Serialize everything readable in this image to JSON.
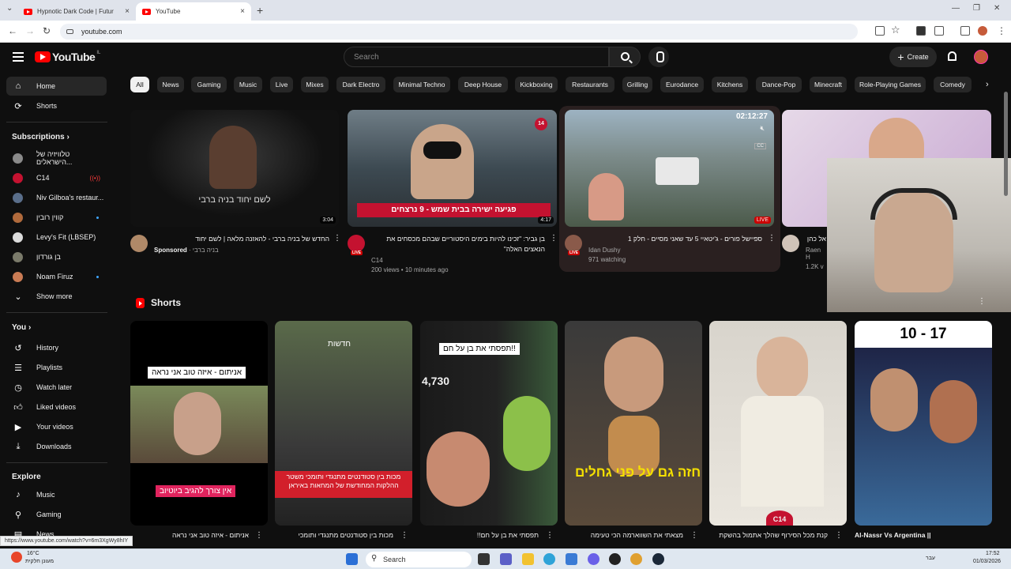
{
  "browser": {
    "tabs": [
      {
        "title": "Hypnotic Dark Code | Futur",
        "active": false
      },
      {
        "title": "YouTube",
        "active": true
      }
    ],
    "url": "youtube.com",
    "status_url": "https://www.youtube.com/watch?v=6m3XgWy8hIY"
  },
  "header": {
    "logo_text": "YouTube",
    "logo_country": "IL",
    "search_placeholder": "Search",
    "create_label": "Create"
  },
  "sidebar": {
    "main": [
      {
        "label": "Home",
        "icon": "home-icon"
      },
      {
        "label": "Shorts",
        "icon": "shorts-icon"
      }
    ],
    "subscriptions_title": "Subscriptions",
    "subscriptions": [
      {
        "label": "טלוויזיה של הישראלים...",
        "color": "#8a8a8a",
        "badge": ""
      },
      {
        "label": "C14",
        "color": "#c41230",
        "badge": "live"
      },
      {
        "label": "Niv Gilboa's restaur...",
        "color": "#5a6e8a",
        "badge": ""
      },
      {
        "label": "קווין רובין",
        "color": "#b06a3c",
        "badge": "dot"
      },
      {
        "label": "Levy's Fit (LBSEP)",
        "color": "#dcdcdc",
        "badge": ""
      },
      {
        "label": "בן גורדון",
        "color": "#7a7a6a",
        "badge": ""
      },
      {
        "label": "Noam Firuz",
        "color": "#c97b54",
        "badge": "dot"
      }
    ],
    "show_more": "Show more",
    "you_title": "You",
    "you": [
      {
        "label": "History",
        "icon": "history-icon"
      },
      {
        "label": "Playlists",
        "icon": "playlists-icon"
      },
      {
        "label": "Watch later",
        "icon": "watch-later-icon"
      },
      {
        "label": "Liked videos",
        "icon": "liked-icon"
      },
      {
        "label": "Your videos",
        "icon": "your-videos-icon"
      },
      {
        "label": "Downloads",
        "icon": "downloads-icon"
      }
    ],
    "explore_title": "Explore",
    "explore": [
      {
        "label": "Music",
        "icon": "music-icon"
      },
      {
        "label": "Gaming",
        "icon": "gaming-icon"
      },
      {
        "label": "News",
        "icon": "news-icon"
      }
    ]
  },
  "chips": [
    "All",
    "News",
    "Gaming",
    "Music",
    "Live",
    "Mixes",
    "Dark Electro",
    "Minimal Techno",
    "Deep House",
    "Kickboxing",
    "Restaurants",
    "Grilling",
    "Eurodance",
    "Kitchens",
    "Dance-Pop",
    "Minecraft",
    "Role-Playing Games",
    "Comedy"
  ],
  "videos": [
    {
      "title": "החדש של בניה ברבי - להאזנה מלאה | לשם יחוד",
      "sponsored": "Sponsored",
      "channel": "בניה ברבי",
      "meta": "",
      "duration": "3:04",
      "thumb_text": "לשם יחוד  בניה ברבי"
    },
    {
      "title": "בן גביר: \"זכינו להיות בימים היסטוריים שבהם מכסחים את הנאצים האלה\"",
      "channel": "C14",
      "meta": "200 views • 10 minutes ago",
      "duration": "4:17",
      "thumb_text": "פגיעה ישירה בבית שמש - 9 נרצחים",
      "badge": "14"
    },
    {
      "title": "ספיישל פורים - ג'יטאיי 5 עד שאני מסיים - חלק 1",
      "channel": "Idan Dushy",
      "meta": "971 watching",
      "duration": "LIVE",
      "timer": "02:12:27"
    },
    {
      "title": "אל כהן",
      "channel": "Raen H",
      "meta": "1.2K v",
      "duration": ""
    }
  ],
  "shorts_title": "Shorts",
  "shorts": [
    {
      "caption": "אניתום - איזה טוב אני נראה",
      "caption2": "אין צורך להגיב ביוטיוב",
      "title": "אניתום - איזה טוב אני נראה"
    },
    {
      "caption": "חדשות",
      "caption2": "מכות בין סטודנטים מתנגדי ותומכי משטר ההלקות המחודשת של המחאות באיראן",
      "title": "מכות בין סטודנטים מתנגדי ותומכי"
    },
    {
      "caption": "תפסתי את בן על חם!!",
      "caption2": "4,730",
      "title": "תפסתי את בן על חם!!"
    },
    {
      "caption": "חזה גם על פני גחלים",
      "caption2": "",
      "title": "מצאתי את השווארמה הכי טעימה"
    },
    {
      "caption": "C14",
      "caption2": "",
      "title": "קנת מכל הסירוף שהלך אתמול בהשקת"
    },
    {
      "caption": "10 - 17",
      "caption2": "",
      "title": "Al-Nassr Vs Argentina ||"
    }
  ],
  "taskbar": {
    "search": "Search",
    "weather_temp": "16°C",
    "weather_desc": "מעונן חלקית",
    "time": "17:52",
    "date": "01/03/2026",
    "lang": "עבר"
  },
  "colors": {
    "bg": "#0f0f0f",
    "accent": "#ff0000",
    "chip": "#272727"
  }
}
